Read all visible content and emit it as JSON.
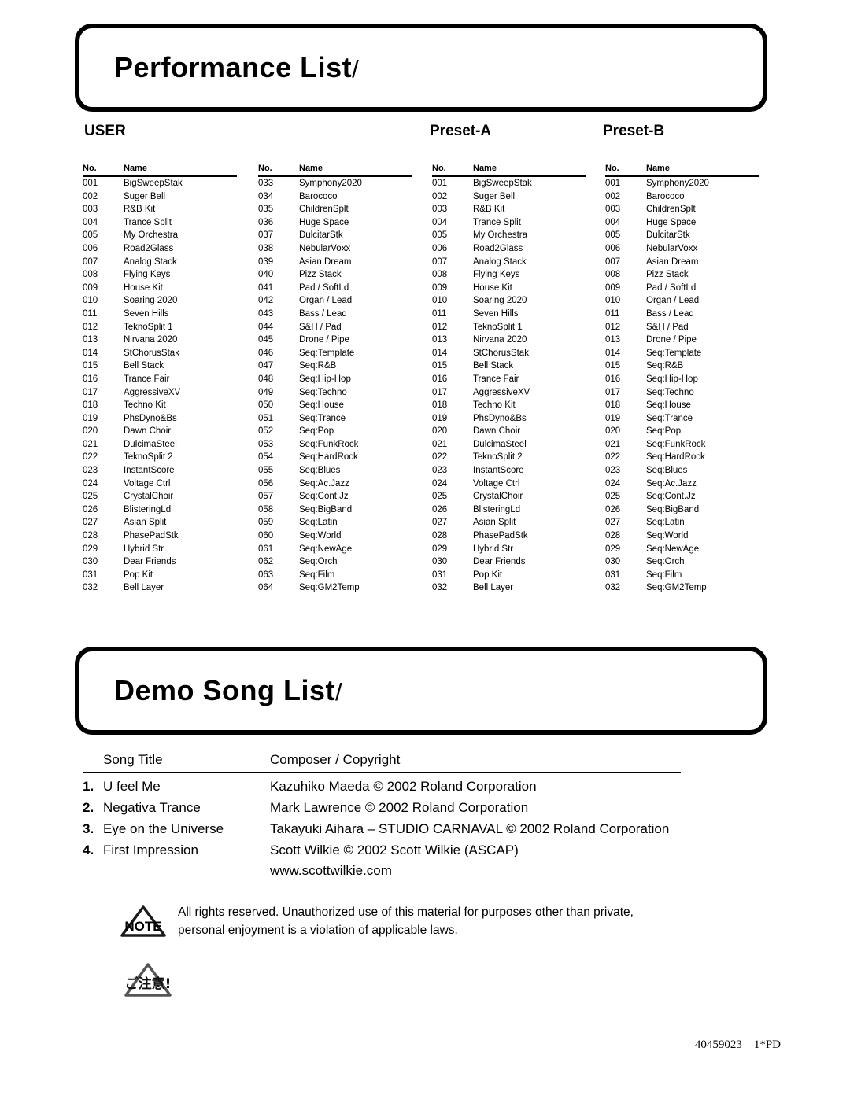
{
  "sections": {
    "performance": {
      "banner_title": "Performance List",
      "banner_slash": "/"
    },
    "demo": {
      "banner_title": "Demo Song List",
      "banner_slash": "/"
    }
  },
  "group_labels": {
    "user": "USER",
    "preset_a": "Preset-A",
    "preset_b": "Preset-B"
  },
  "table_headers": {
    "no": "No.",
    "name": "Name"
  },
  "performance_columns": [
    {
      "group": "USER",
      "rows": [
        {
          "no": "001",
          "name": "BigSweepStak"
        },
        {
          "no": "002",
          "name": "Suger Bell"
        },
        {
          "no": "003",
          "name": "R&B Kit"
        },
        {
          "no": "004",
          "name": "Trance Split"
        },
        {
          "no": "005",
          "name": "My Orchestra"
        },
        {
          "no": "006",
          "name": "Road2Glass"
        },
        {
          "no": "007",
          "name": "Analog Stack"
        },
        {
          "no": "008",
          "name": "Flying Keys"
        },
        {
          "no": "009",
          "name": "House Kit"
        },
        {
          "no": "010",
          "name": "Soaring 2020"
        },
        {
          "no": "011",
          "name": "Seven Hills"
        },
        {
          "no": "012",
          "name": "TeknoSplit 1"
        },
        {
          "no": "013",
          "name": "Nirvana 2020"
        },
        {
          "no": "014",
          "name": "StChorusStak"
        },
        {
          "no": "015",
          "name": "Bell Stack"
        },
        {
          "no": "016",
          "name": "Trance Fair"
        },
        {
          "no": "017",
          "name": "AggressiveXV"
        },
        {
          "no": "018",
          "name": "Techno Kit"
        },
        {
          "no": "019",
          "name": "PhsDyno&Bs"
        },
        {
          "no": "020",
          "name": "Dawn Choir"
        },
        {
          "no": "021",
          "name": "DulcimaSteel"
        },
        {
          "no": "022",
          "name": "TeknoSplit 2"
        },
        {
          "no": "023",
          "name": "InstantScore"
        },
        {
          "no": "024",
          "name": "Voltage Ctrl"
        },
        {
          "no": "025",
          "name": "CrystalChoir"
        },
        {
          "no": "026",
          "name": "BlisteringLd"
        },
        {
          "no": "027",
          "name": "Asian Split"
        },
        {
          "no": "028",
          "name": "PhasePadStk"
        },
        {
          "no": "029",
          "name": "Hybrid Str"
        },
        {
          "no": "030",
          "name": "Dear Friends"
        },
        {
          "no": "031",
          "name": "Pop Kit"
        },
        {
          "no": "032",
          "name": "Bell Layer"
        }
      ]
    },
    {
      "group": "USER",
      "rows": [
        {
          "no": "033",
          "name": "Symphony2020"
        },
        {
          "no": "034",
          "name": "Barococo"
        },
        {
          "no": "035",
          "name": "ChildrenSplt"
        },
        {
          "no": "036",
          "name": "Huge Space"
        },
        {
          "no": "037",
          "name": "DulcitarStk"
        },
        {
          "no": "038",
          "name": "NebularVoxx"
        },
        {
          "no": "039",
          "name": "Asian Dream"
        },
        {
          "no": "040",
          "name": "Pizz Stack"
        },
        {
          "no": "041",
          "name": "Pad / SoftLd"
        },
        {
          "no": "042",
          "name": "Organ / Lead"
        },
        {
          "no": "043",
          "name": "Bass / Lead"
        },
        {
          "no": "044",
          "name": "S&H / Pad"
        },
        {
          "no": "045",
          "name": "Drone / Pipe"
        },
        {
          "no": "046",
          "name": "Seq:Template"
        },
        {
          "no": "047",
          "name": "Seq:R&B"
        },
        {
          "no": "048",
          "name": "Seq:Hip-Hop"
        },
        {
          "no": "049",
          "name": "Seq:Techno"
        },
        {
          "no": "050",
          "name": "Seq:House"
        },
        {
          "no": "051",
          "name": "Seq:Trance"
        },
        {
          "no": "052",
          "name": "Seq:Pop"
        },
        {
          "no": "053",
          "name": "Seq:FunkRock"
        },
        {
          "no": "054",
          "name": "Seq:HardRock"
        },
        {
          "no": "055",
          "name": "Seq:Blues"
        },
        {
          "no": "056",
          "name": "Seq:Ac.Jazz"
        },
        {
          "no": "057",
          "name": "Seq:Cont.Jz"
        },
        {
          "no": "058",
          "name": "Seq:BigBand"
        },
        {
          "no": "059",
          "name": "Seq:Latin"
        },
        {
          "no": "060",
          "name": "Seq:World"
        },
        {
          "no": "061",
          "name": "Seq:NewAge"
        },
        {
          "no": "062",
          "name": "Seq:Orch"
        },
        {
          "no": "063",
          "name": "Seq:Film"
        },
        {
          "no": "064",
          "name": "Seq:GM2Temp"
        }
      ]
    },
    {
      "group": "Preset-A",
      "rows": [
        {
          "no": "001",
          "name": "BigSweepStak"
        },
        {
          "no": "002",
          "name": "Suger Bell"
        },
        {
          "no": "003",
          "name": "R&B Kit"
        },
        {
          "no": "004",
          "name": "Trance Split"
        },
        {
          "no": "005",
          "name": "My Orchestra"
        },
        {
          "no": "006",
          "name": "Road2Glass"
        },
        {
          "no": "007",
          "name": "Analog Stack"
        },
        {
          "no": "008",
          "name": "Flying Keys"
        },
        {
          "no": "009",
          "name": "House Kit"
        },
        {
          "no": "010",
          "name": "Soaring 2020"
        },
        {
          "no": "011",
          "name": "Seven Hills"
        },
        {
          "no": "012",
          "name": "TeknoSplit 1"
        },
        {
          "no": "013",
          "name": "Nirvana 2020"
        },
        {
          "no": "014",
          "name": "StChorusStak"
        },
        {
          "no": "015",
          "name": "Bell Stack"
        },
        {
          "no": "016",
          "name": "Trance Fair"
        },
        {
          "no": "017",
          "name": "AggressiveXV"
        },
        {
          "no": "018",
          "name": "Techno Kit"
        },
        {
          "no": "019",
          "name": "PhsDyno&Bs"
        },
        {
          "no": "020",
          "name": "Dawn Choir"
        },
        {
          "no": "021",
          "name": "DulcimaSteel"
        },
        {
          "no": "022",
          "name": "TeknoSplit 2"
        },
        {
          "no": "023",
          "name": "InstantScore"
        },
        {
          "no": "024",
          "name": "Voltage Ctrl"
        },
        {
          "no": "025",
          "name": "CrystalChoir"
        },
        {
          "no": "026",
          "name": "BlisteringLd"
        },
        {
          "no": "027",
          "name": "Asian Split"
        },
        {
          "no": "028",
          "name": "PhasePadStk"
        },
        {
          "no": "029",
          "name": "Hybrid Str"
        },
        {
          "no": "030",
          "name": "Dear Friends"
        },
        {
          "no": "031",
          "name": "Pop Kit"
        },
        {
          "no": "032",
          "name": "Bell Layer"
        }
      ]
    },
    {
      "group": "Preset-B",
      "rows": [
        {
          "no": "001",
          "name": "Symphony2020"
        },
        {
          "no": "002",
          "name": "Barococo"
        },
        {
          "no": "003",
          "name": "ChildrenSplt"
        },
        {
          "no": "004",
          "name": "Huge Space"
        },
        {
          "no": "005",
          "name": "DulcitarStk"
        },
        {
          "no": "006",
          "name": "NebularVoxx"
        },
        {
          "no": "007",
          "name": "Asian Dream"
        },
        {
          "no": "008",
          "name": "Pizz Stack"
        },
        {
          "no": "009",
          "name": "Pad / SoftLd"
        },
        {
          "no": "010",
          "name": "Organ / Lead"
        },
        {
          "no": "011",
          "name": "Bass / Lead"
        },
        {
          "no": "012",
          "name": "S&H / Pad"
        },
        {
          "no": "013",
          "name": "Drone / Pipe"
        },
        {
          "no": "014",
          "name": "Seq:Template"
        },
        {
          "no": "015",
          "name": "Seq:R&B"
        },
        {
          "no": "016",
          "name": "Seq:Hip-Hop"
        },
        {
          "no": "017",
          "name": "Seq:Techno"
        },
        {
          "no": "018",
          "name": "Seq:House"
        },
        {
          "no": "019",
          "name": "Seq:Trance"
        },
        {
          "no": "020",
          "name": "Seq:Pop"
        },
        {
          "no": "021",
          "name": "Seq:FunkRock"
        },
        {
          "no": "022",
          "name": "Seq:HardRock"
        },
        {
          "no": "023",
          "name": "Seq:Blues"
        },
        {
          "no": "024",
          "name": "Seq:Ac.Jazz"
        },
        {
          "no": "025",
          "name": "Seq:Cont.Jz"
        },
        {
          "no": "026",
          "name": "Seq:BigBand"
        },
        {
          "no": "027",
          "name": "Seq:Latin"
        },
        {
          "no": "028",
          "name": "Seq:World"
        },
        {
          "no": "029",
          "name": "Seq:NewAge"
        },
        {
          "no": "030",
          "name": "Seq:Orch"
        },
        {
          "no": "031",
          "name": "Seq:Film"
        },
        {
          "no": "032",
          "name": "Seq:GM2Temp"
        }
      ]
    }
  ],
  "song_table": {
    "headers": {
      "title": "Song Title",
      "credit": "Composer / Copyright"
    },
    "rows": [
      {
        "index": "1.",
        "title": "U feel Me",
        "credit": "Kazuhiko Maeda © 2002 Roland Corporation",
        "credit_line2": ""
      },
      {
        "index": "2.",
        "title": "Negativa Trance",
        "credit": "Mark Lawrence © 2002 Roland Corporation",
        "credit_line2": ""
      },
      {
        "index": "3.",
        "title": "Eye on the Universe",
        "credit": "Takayuki Aihara – STUDIO CARNAVAL © 2002 Roland Corporation",
        "credit_line2": ""
      },
      {
        "index": "4.",
        "title": "First Impression",
        "credit": "Scott Wilkie © 2002 Scott Wilkie (ASCAP)",
        "credit_line2": "www.scottwilkie.com"
      }
    ]
  },
  "note": {
    "icon_label": "NOTE",
    "line1": "All rights reserved. Unauthorized use of this material for purposes other than private,",
    "line2": "personal enjoyment is a violation of applicable laws."
  },
  "caution": {
    "icon_label": "ご注意!"
  },
  "footer": {
    "text": "40459023    1*PD"
  }
}
